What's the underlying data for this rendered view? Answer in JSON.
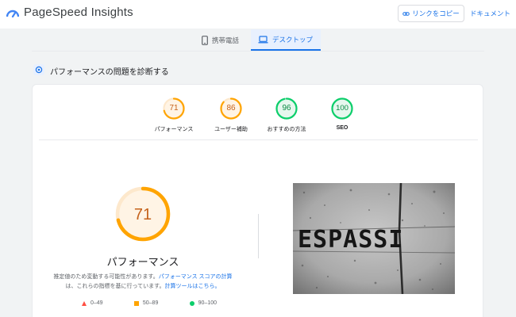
{
  "header": {
    "brand": "PageSpeed Insights",
    "copy_link": "リンクをコピー",
    "docs": "ドキュメント",
    "logo_icon": "pagespeed-logo-icon",
    "link_icon": "link-icon"
  },
  "tabs": [
    {
      "label": "携帯電話",
      "icon": "smartphone-icon",
      "selected": false
    },
    {
      "label": "デスクトップ",
      "icon": "laptop-icon",
      "selected": true
    }
  ],
  "section": {
    "title": "パフォーマンスの問題を診断する",
    "icon": "diagnose-icon"
  },
  "scores": [
    {
      "value": "71",
      "label": "パフォーマンス",
      "color": "#e8710a"
    },
    {
      "value": "86",
      "label": "ユーザー補助",
      "color": "#e8710a"
    },
    {
      "value": "96",
      "label": "おすすめの方法",
      "color": "#0b9a4a"
    },
    {
      "value": "100",
      "label": "SEO",
      "color": "#0b9a4a"
    }
  ],
  "performance": {
    "score": "71",
    "score_fraction": 0.71,
    "label": "パフォーマンス",
    "note_1": "推定値のため変動する可能性があります。",
    "note_link_1": "パフォーマンス スコアの計算",
    "note_2": "は、これらの指標を基に行っています。",
    "note_link_2": "計算ツールはこちら。"
  },
  "legend": [
    {
      "range": "0–49",
      "shape": "triangle",
      "color": "#ff4e42"
    },
    {
      "range": "50–89",
      "shape": "square",
      "color": "#ffa400"
    },
    {
      "range": "90–100",
      "shape": "circle",
      "color": "#0cce6b"
    }
  ],
  "screenshot": {
    "text": "ESPASSI"
  }
}
